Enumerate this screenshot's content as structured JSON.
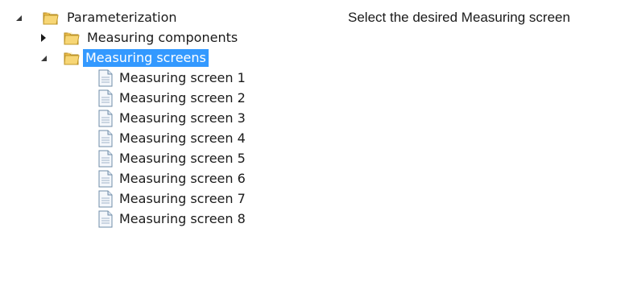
{
  "instruction": "Select the desired Measuring screen",
  "selection_color": "#3399ff",
  "tree": {
    "root": {
      "label": "Parameterization",
      "icon": "folder-icon",
      "expanded": true
    },
    "measuring_components": {
      "label": "Measuring components",
      "icon": "folder-icon",
      "expanded": false
    },
    "measuring_screens": {
      "label": "Measuring screens",
      "icon": "folder-icon",
      "expanded": true,
      "selected": true,
      "items": [
        {
          "label": "Measuring screen 1",
          "icon": "document-icon"
        },
        {
          "label": "Measuring screen 2",
          "icon": "document-icon"
        },
        {
          "label": "Measuring screen 3",
          "icon": "document-icon"
        },
        {
          "label": "Measuring screen 4",
          "icon": "document-icon"
        },
        {
          "label": "Measuring screen 5",
          "icon": "document-icon"
        },
        {
          "label": "Measuring screen 6",
          "icon": "document-icon"
        },
        {
          "label": "Measuring screen 7",
          "icon": "document-icon"
        },
        {
          "label": "Measuring screen 8",
          "icon": "document-icon"
        }
      ]
    }
  }
}
